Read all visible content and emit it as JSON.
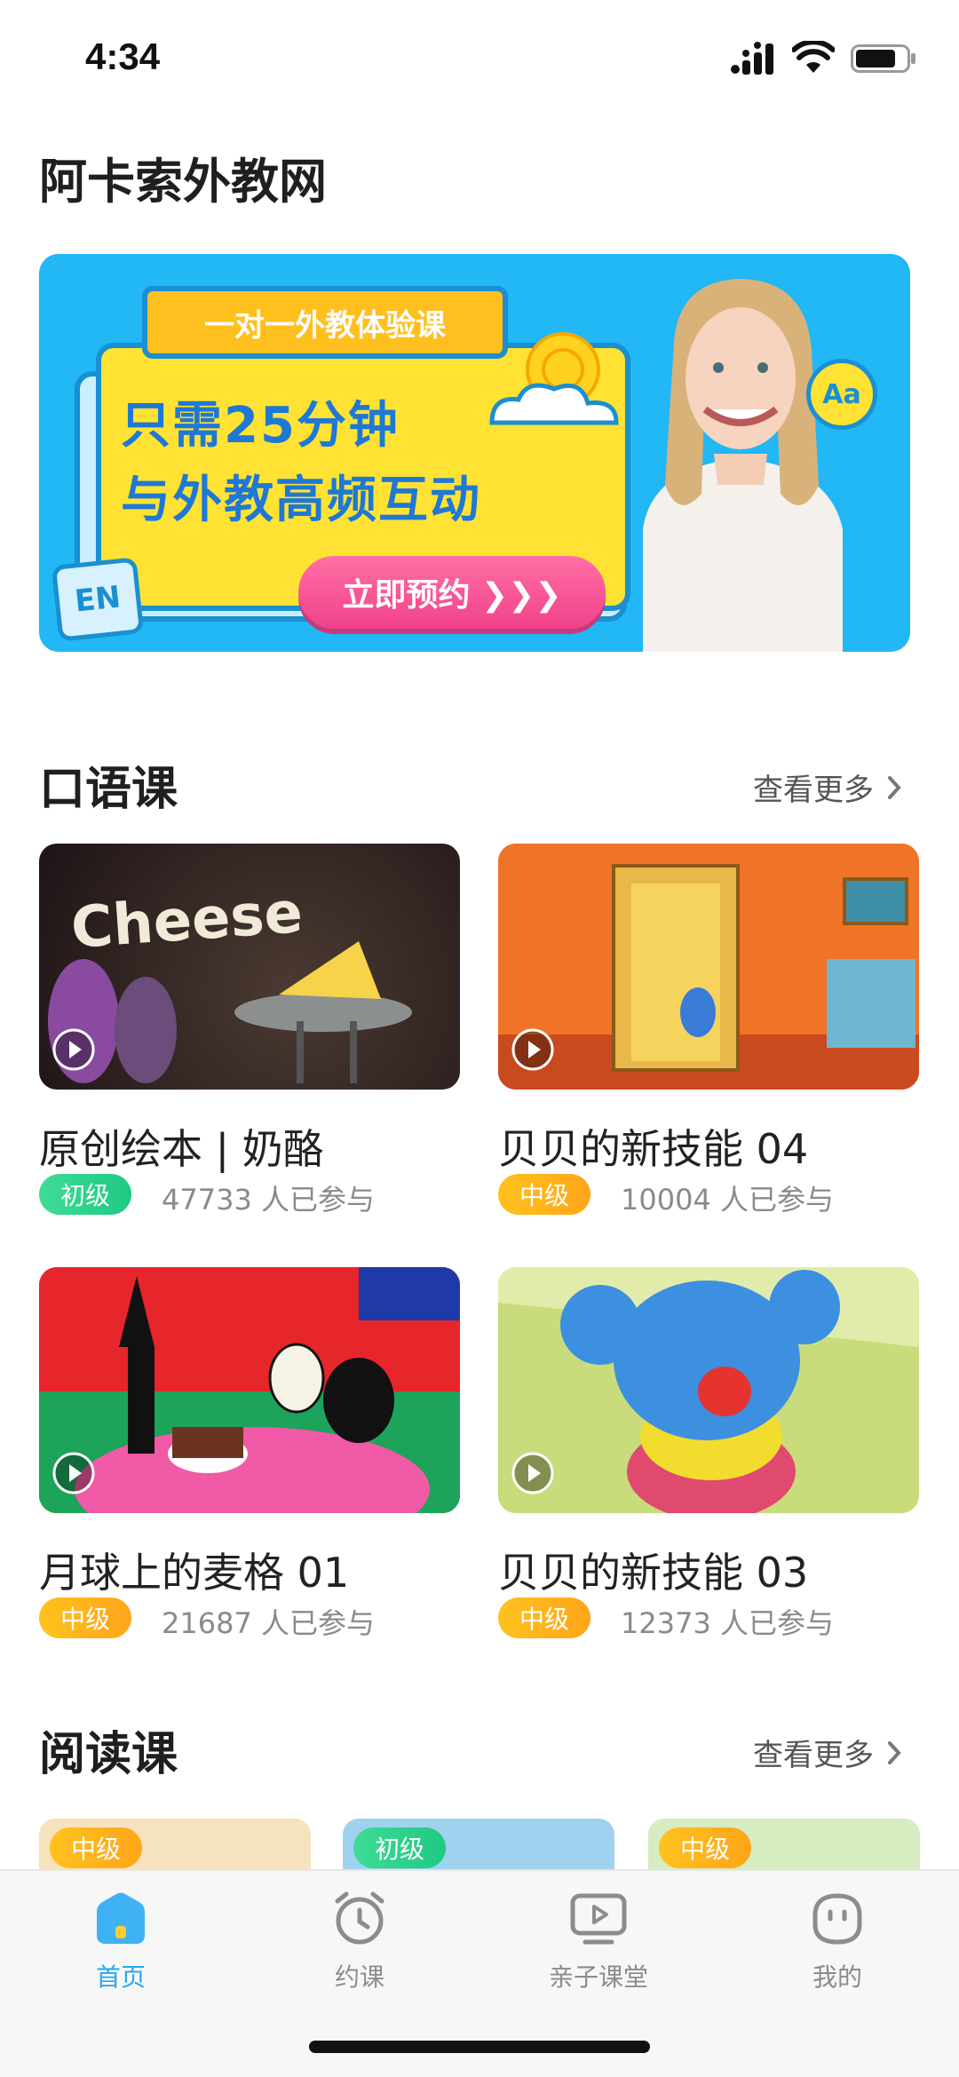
{
  "status_bar": {
    "time": "4:34"
  },
  "header": {
    "title": "阿卡索外教网"
  },
  "banner": {
    "tab_text": "一对一外教体验课",
    "line1": "只需25分钟",
    "line2": "与外教高频互动",
    "button": "立即预约 ❯❯❯",
    "badge_en": "EN",
    "badge_aa": "Aa"
  },
  "speaking_section": {
    "title": "口语课",
    "see_more": "查看更多",
    "courses": [
      {
        "title": "原创绘本 | 奶酪",
        "level": "初级",
        "participants": "47733 人已参与",
        "thumb_text": "Cheese"
      },
      {
        "title": "贝贝的新技能 04",
        "level": "中级",
        "participants": "10004 人已参与"
      },
      {
        "title": "月球上的麦格 01",
        "level": "中级",
        "participants": "21687 人已参与"
      },
      {
        "title": "贝贝的新技能 03",
        "level": "中级",
        "participants": "12373 人已参与"
      }
    ]
  },
  "reading_section": {
    "title": "阅读课",
    "see_more": "查看更多",
    "badges": [
      "中级",
      "初级",
      "中级"
    ]
  },
  "tab_bar": {
    "items": [
      {
        "label": "首页",
        "icon": "home-icon",
        "active": true
      },
      {
        "label": "约课",
        "icon": "alarm-clock-icon",
        "active": false
      },
      {
        "label": "亲子课堂",
        "icon": "video-play-icon",
        "active": false
      },
      {
        "label": "我的",
        "icon": "profile-face-icon",
        "active": false
      }
    ]
  },
  "colors": {
    "accent": "#27a7f2",
    "badge_beginner": "#2bd38a",
    "badge_intermediate": "#ffb400",
    "banner_bg": "#22b7f5"
  }
}
